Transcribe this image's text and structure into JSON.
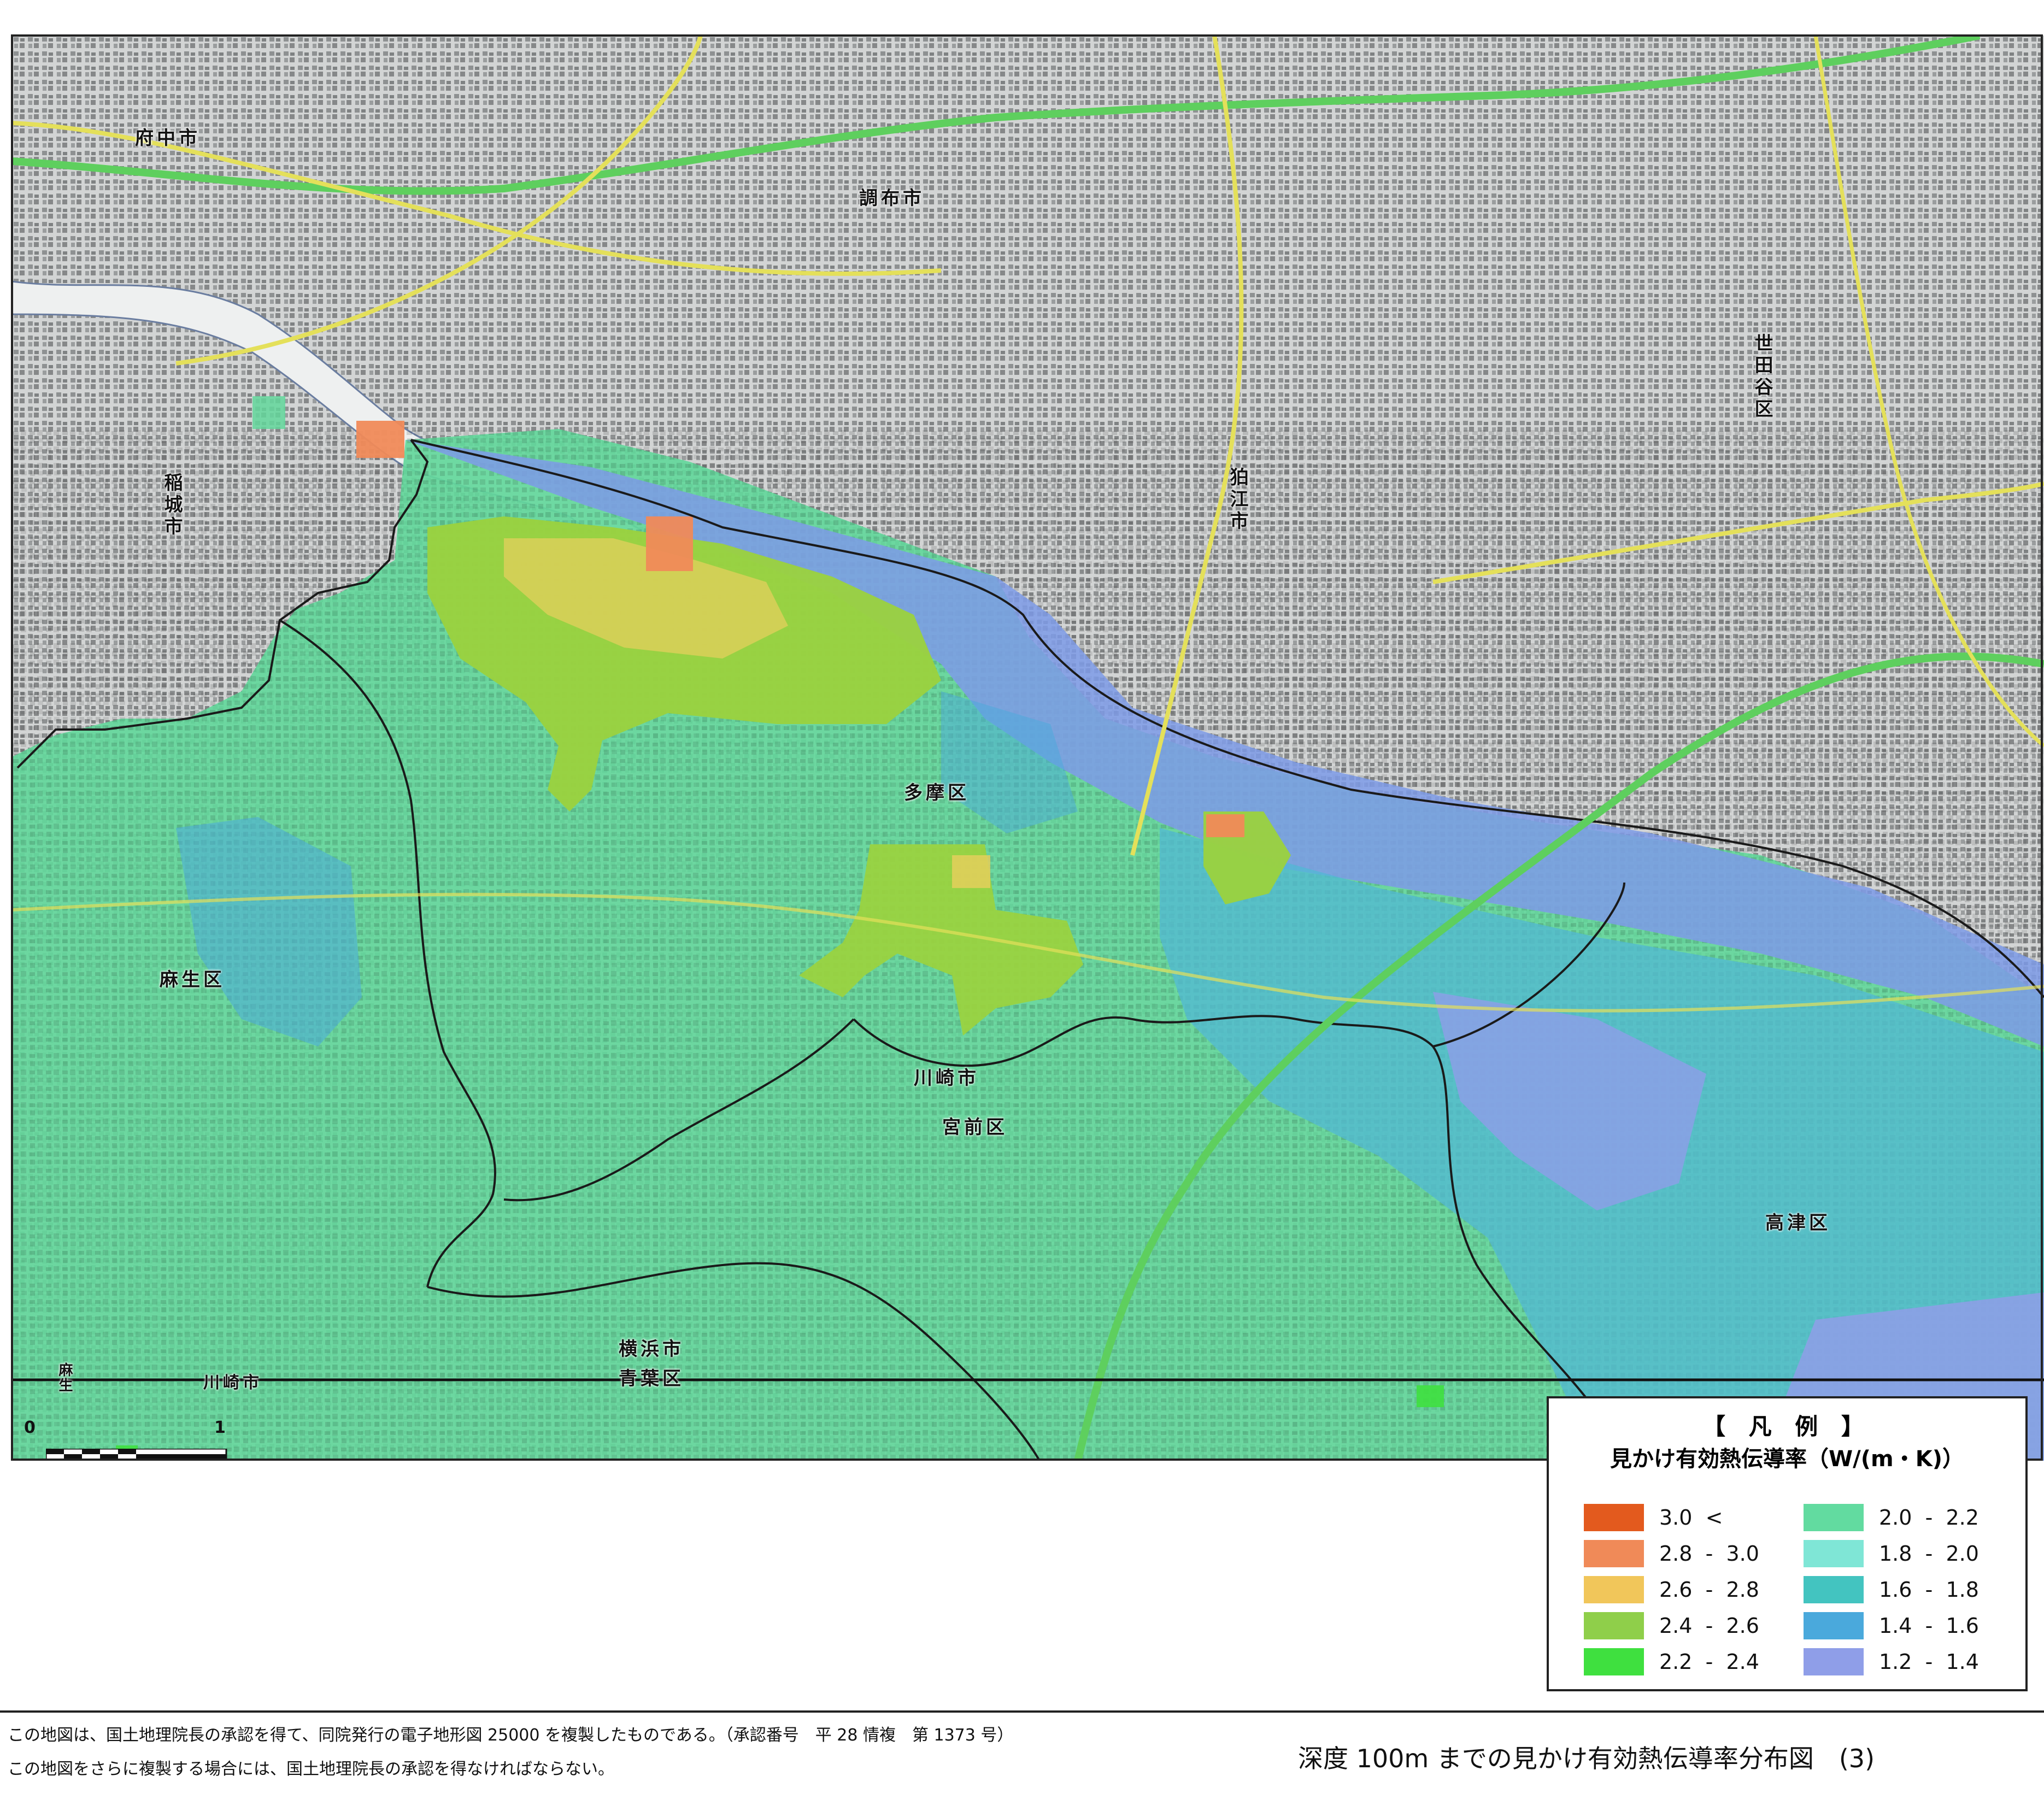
{
  "map": {
    "place_labels": [
      {
        "id": "fuchu",
        "text": "府中市",
        "vertical": false
      },
      {
        "id": "chofu",
        "text": "調布市",
        "vertical": false
      },
      {
        "id": "setagaya",
        "text": "世田谷区",
        "vertical": true
      },
      {
        "id": "komae",
        "text": "狛江市",
        "vertical": true
      },
      {
        "id": "inagi",
        "text": "稲城市",
        "vertical": true
      },
      {
        "id": "tama",
        "text": "多摩区",
        "vertical": false
      },
      {
        "id": "asao",
        "text": "麻生区",
        "vertical": false
      },
      {
        "id": "kawasaki",
        "text": "川崎市",
        "vertical": false
      },
      {
        "id": "miyamae",
        "text": "宮前区",
        "vertical": false
      },
      {
        "id": "takatsu",
        "text": "高津区",
        "vertical": false
      },
      {
        "id": "yokohama",
        "text": "横浜市",
        "vertical": false
      },
      {
        "id": "aoba",
        "text": "青葉区",
        "vertical": false
      },
      {
        "id": "kawasaki2",
        "text": "川崎市",
        "vertical": false
      },
      {
        "id": "asao2",
        "text": "麻生",
        "vertical": true
      }
    ],
    "scale_bar": {
      "start": "0",
      "end": "1",
      "unit": "km"
    }
  },
  "legend": {
    "title": "【 凡 例 】",
    "subtitle": "見かけ有効熱伝導率（W/(m・K)）",
    "items": [
      {
        "label": "3.0  <",
        "color": "#e35a1e"
      },
      {
        "label": "2.8  -  3.0",
        "color": "#f08a58"
      },
      {
        "label": "2.6  -  2.8",
        "color": "#f1c65a"
      },
      {
        "label": "2.4  -  2.6",
        "color": "#8fcf4a"
      },
      {
        "label": "2.2  -  2.4",
        "color": "#3fe03f"
      },
      {
        "label": "2.0  -  2.2",
        "color": "#62dba0"
      },
      {
        "label": "1.8  -  2.0",
        "color": "#7fe6d6"
      },
      {
        "label": "1.6  -  1.8",
        "color": "#43c4c0"
      },
      {
        "label": "1.4  -  1.6",
        "color": "#4aa9dc"
      },
      {
        "label": "1.2  -  1.4",
        "color": "#8f9ee8"
      }
    ]
  },
  "footer": {
    "note1": "この地図は、国土地理院長の承認を得て、同院発行の電子地形図 25000 を複製したものである。（承認番号　平 28 情複　第 1373 号）",
    "note2": "この地図をさらに複製する場合には、国土地理院長の承認を得なければならない。",
    "title": "深度 100m までの見かけ有効熱伝導率分布図　(3)"
  }
}
